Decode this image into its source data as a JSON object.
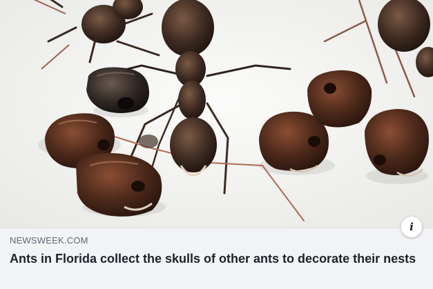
{
  "link_preview": {
    "image": {
      "description_icon": "info-icon",
      "info_label": "i"
    },
    "domain": "NEWSWEEK.COM",
    "headline": "Ants in Florida collect the skulls of other ants to decorate their nests"
  },
  "colors": {
    "background": "#f2f3f5",
    "domain_text": "#606770",
    "headline_text": "#1d2129",
    "ant_body": "#3b2a20",
    "skull": "#4a2a1c"
  }
}
